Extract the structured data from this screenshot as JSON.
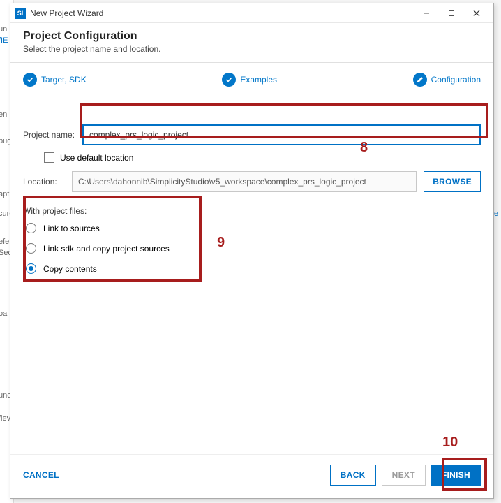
{
  "titlebar": {
    "app_icon_text": "SI",
    "title": "New Project Wizard"
  },
  "header": {
    "title": "Project Configuration",
    "subtitle": "Select the project name and location."
  },
  "steps": {
    "target": "Target, SDK",
    "examples": "Examples",
    "config": "Configuration"
  },
  "fields": {
    "project_name_label": "Project name:",
    "project_name_value": "complex_prs_logic_project",
    "use_default_label": "Use default location",
    "location_label": "Location:",
    "location_value": "C:\\Users\\dahonnib\\SimplicityStudio\\v5_workspace\\complex_prs_logic_project",
    "browse_label": "BROWSE"
  },
  "project_files": {
    "section_label": "With project files:",
    "opt_link_sources": "Link to sources",
    "opt_link_sdk_copy": "Link sdk and copy project sources",
    "opt_copy_contents": "Copy contents"
  },
  "buttons": {
    "cancel": "CANCEL",
    "back": "BACK",
    "next": "NEXT",
    "finish": "FINISH"
  },
  "callouts": {
    "n8": "8",
    "n9": "9",
    "n10": "10"
  },
  "bg_peek": {
    "p1": "un",
    "p2": "/IE",
    "p3": "en",
    "p4": "bug",
    "p5": "apt",
    "p6": "cure",
    "p7": "efe",
    "p8": "Sec",
    "p9": "oa",
    "p10": "unc",
    "p11": "/iev",
    "p12": "e"
  }
}
